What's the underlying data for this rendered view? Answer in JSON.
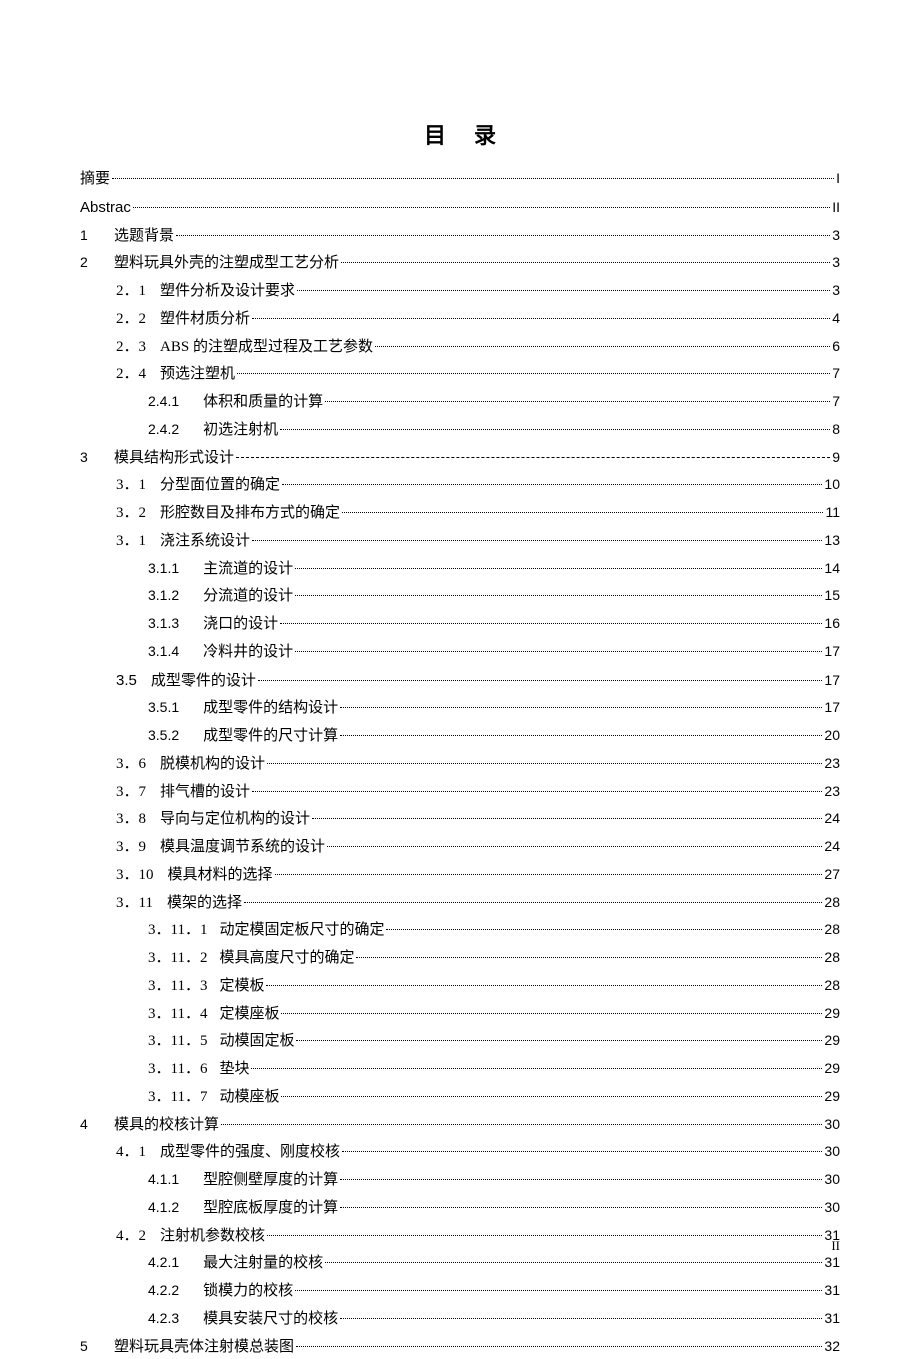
{
  "title": "目录",
  "footer_page": "II",
  "entries": [
    {
      "indent": 0,
      "num": "",
      "label": "摘要",
      "page": "I",
      "numcls": ""
    },
    {
      "indent": 0,
      "num": "",
      "label": "Abstrac",
      "page": "II",
      "numcls": "",
      "labelcls": "latin"
    },
    {
      "indent": 0,
      "num": "1",
      "label": "选题背景",
      "page": "3",
      "numcls": "chapnum"
    },
    {
      "indent": 0,
      "num": "2",
      "label": "塑料玩具外壳的注塑成型工艺分析",
      "page": "3",
      "numcls": "chapnum"
    },
    {
      "indent": 1,
      "num": "2．1",
      "label": "塑件分析及设计要求",
      "page": "3",
      "numcls": "secnum"
    },
    {
      "indent": 1,
      "num": "2．2",
      "label": "塑件材质分析",
      "page": "4",
      "numcls": "secnum"
    },
    {
      "indent": 1,
      "num": "2．3",
      "label": "ABS 的注塑成型过程及工艺参数",
      "page": "6",
      "numcls": "secnum"
    },
    {
      "indent": 1,
      "num": "2．4",
      "label": "预选注塑机",
      "page": "7",
      "numcls": "secnum"
    },
    {
      "indent": 2,
      "num": "2.4.1",
      "label": "体积和质量的计算",
      "page": "7",
      "numcls": "subnum"
    },
    {
      "indent": 2,
      "num": "2.4.2",
      "label": "初选注射机",
      "page": "8",
      "numcls": "subnum"
    },
    {
      "indent": 0,
      "num": "3",
      "label": "模具结构形式设计",
      "page": "9",
      "numcls": "chapnum",
      "leader": "dash"
    },
    {
      "indent": 1,
      "num": "3．1",
      "label": "分型面位置的确定",
      "page": "10",
      "numcls": "secnum"
    },
    {
      "indent": 1,
      "num": "3．2",
      "label": "形腔数目及排布方式的确定",
      "page": "11",
      "numcls": "secnum"
    },
    {
      "indent": 1,
      "num": "3．1",
      "label": "浇注系统设计",
      "page": "13",
      "numcls": "secnum"
    },
    {
      "indent": 2,
      "num": "3.1.1",
      "label": "主流道的设计",
      "page": "14",
      "numcls": "subnum"
    },
    {
      "indent": 2,
      "num": "3.1.2",
      "label": "分流道的设计",
      "page": "15",
      "numcls": "subnum"
    },
    {
      "indent": 2,
      "num": "3.1.3",
      "label": "浇口的设计",
      "page": "16",
      "numcls": "subnum"
    },
    {
      "indent": 2,
      "num": "3.1.4",
      "label": "冷料井的设计",
      "page": "17",
      "numcls": "subnum"
    },
    {
      "indent": 1,
      "num": "3.5",
      "label": "成型零件的设计",
      "page": "17",
      "numcls": "secnum",
      "numstylelatin": true
    },
    {
      "indent": 2,
      "num": "3.5.1",
      "label": "成型零件的结构设计",
      "page": "17",
      "numcls": "subnum"
    },
    {
      "indent": 2,
      "num": "3.5.2",
      "label": "成型零件的尺寸计算",
      "page": "20",
      "numcls": "subnum"
    },
    {
      "indent": 1,
      "num": "3．6",
      "label": "脱模机构的设计",
      "page": "23",
      "numcls": "secnum"
    },
    {
      "indent": 1,
      "num": "3．7",
      "label": "排气槽的设计",
      "page": "23",
      "numcls": "secnum"
    },
    {
      "indent": 1,
      "num": "3．8",
      "label": "导向与定位机构的设计",
      "page": "24",
      "numcls": "secnum"
    },
    {
      "indent": 1,
      "num": "3．9",
      "label": "模具温度调节系统的设计",
      "page": "24",
      "numcls": "secnum"
    },
    {
      "indent": 1,
      "num": "3．10",
      "label": "模具材料的选择",
      "page": "27",
      "numcls": "secnum"
    },
    {
      "indent": 1,
      "num": "3．11",
      "label": "模架的选择",
      "page": "28",
      "numcls": "secnum"
    },
    {
      "indent": 2,
      "num": "3．11．1",
      "label": "动定模固定板尺寸的确定",
      "page": "28",
      "numcls": "subnum-cn"
    },
    {
      "indent": 2,
      "num": "3．11．2",
      "label": "模具高度尺寸的确定",
      "page": "28",
      "numcls": "subnum-cn"
    },
    {
      "indent": 2,
      "num": "3．11．3",
      "label": "定模板",
      "page": "28",
      "numcls": "subnum-cn"
    },
    {
      "indent": 2,
      "num": "3．11．4",
      "label": "定模座板",
      "page": "29",
      "numcls": "subnum-cn"
    },
    {
      "indent": 2,
      "num": "3．11．5",
      "label": "动模固定板",
      "page": "29",
      "numcls": "subnum-cn"
    },
    {
      "indent": 2,
      "num": "3．11．6",
      "label": "垫块",
      "page": "29",
      "numcls": "subnum-cn"
    },
    {
      "indent": 2,
      "num": "3．11．7",
      "label": "动模座板",
      "page": "29",
      "numcls": "subnum-cn"
    },
    {
      "indent": 0,
      "num": "4",
      "label": "模具的校核计算",
      "page": "30",
      "numcls": "chapnum"
    },
    {
      "indent": 1,
      "num": "4．1",
      "label": "成型零件的强度、刚度校核",
      "page": "30",
      "numcls": "secnum"
    },
    {
      "indent": 2,
      "num": "4.1.1",
      "label": "型腔侧壁厚度的计算",
      "page": "30",
      "numcls": "subnum"
    },
    {
      "indent": 2,
      "num": "4.1.2",
      "label": "型腔底板厚度的计算",
      "page": "30",
      "numcls": "subnum"
    },
    {
      "indent": 1,
      "num": "4．2",
      "label": "注射机参数校核",
      "page": "31",
      "numcls": "secnum"
    },
    {
      "indent": 2,
      "num": "4.2.1",
      "label": "最大注射量的校核",
      "page": "31",
      "numcls": "subnum"
    },
    {
      "indent": 2,
      "num": "4.2.2",
      "label": "锁模力的校核",
      "page": "31",
      "numcls": "subnum"
    },
    {
      "indent": 2,
      "num": "4.2.3",
      "label": "模具安装尺寸的校核",
      "page": "31",
      "numcls": "subnum"
    },
    {
      "indent": 0,
      "num": "5",
      "label": "塑料玩具壳体注射模总装图",
      "page": "32",
      "numcls": "chapnum"
    }
  ]
}
